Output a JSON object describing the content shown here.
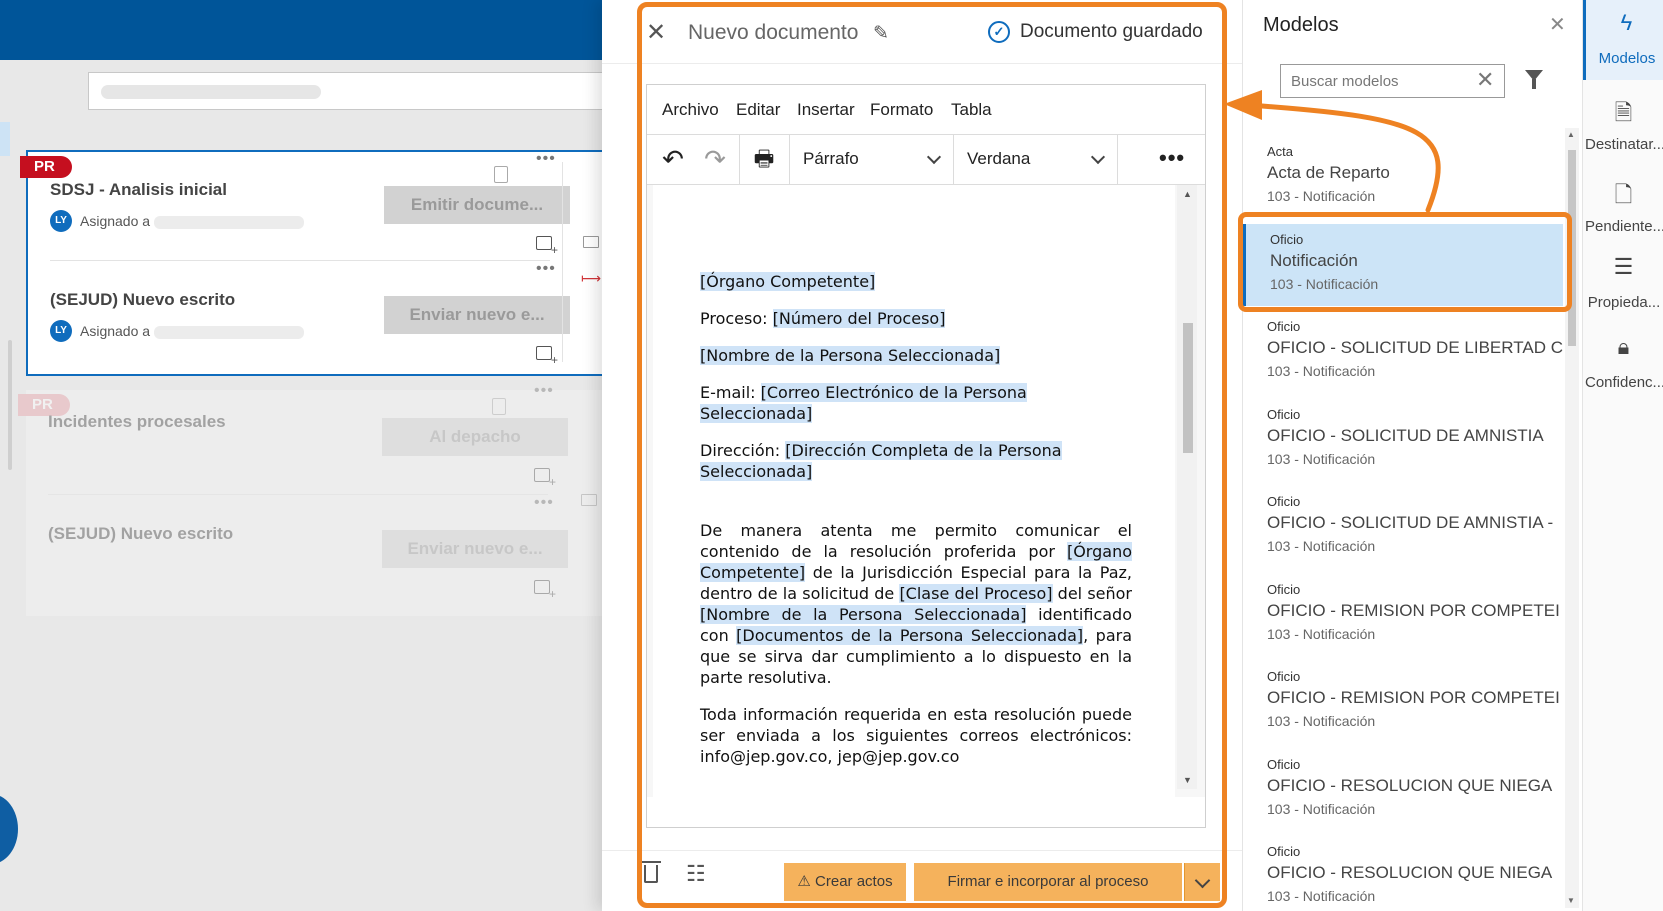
{
  "editor": {
    "title": "Nuevo documento",
    "save_status": "Documento guardado",
    "menu": [
      "Archivo",
      "Editar",
      "Insertar",
      "Formato",
      "Tabla"
    ],
    "block_format": "Párrafo",
    "font_family": "Verdana",
    "content": {
      "organ": "[Órgano Competente]",
      "proceso_label": "Proceso: ",
      "proceso_value": "[Número del Proceso]",
      "nombre": "[Nombre de la Persona Seleccionada]",
      "email_label": "E-mail: ",
      "email_value": "[Correo Electrónico de la Persona Seleccionada]",
      "direccion_label": "Dirección: ",
      "direccion_value": "[Dirección Completa de la Persona Seleccionada]",
      "p1_a": "De manera atenta me permito comunicar el contenido de la resolución proferida por ",
      "p1_organ": "[Órgano Competente]",
      "p1_b": " de la Jurisdicción Especial para la Paz, dentro de la solicitud de ",
      "p1_clase": "[Clase del Proceso]",
      "p1_c": " del señor ",
      "p1_nombre": "[Nombre de la Persona Seleccionada]",
      "p1_d": " identificado con ",
      "p1_docs": "[Documentos de la Persona Seleccionada]",
      "p1_e": ", para que se sirva dar cumplimiento a lo dispuesto en la parte resolutiva.",
      "p2": "Toda información requerida en esta resolución puede ser enviada a los siguientes correos electrónicos: info@jep.gov.co, jep@jep.gov.co"
    },
    "footer": {
      "create_acts": "⚠ Crear actos",
      "sign_incorporate": "Firmar e incorporar al proceso"
    }
  },
  "models": {
    "title": "Modelos",
    "search_placeholder": "Buscar modelos",
    "items": [
      {
        "category": "Acta",
        "name": "Acta de Reparto",
        "sub": "103 - Notificación",
        "selected": false
      },
      {
        "category": "Oficio",
        "name": "Notificación",
        "sub": "103 - Notificación",
        "selected": true
      },
      {
        "category": "Oficio",
        "name": "OFICIO - SOLICITUD DE LIBERTAD C",
        "sub": "103 - Notificación",
        "selected": false
      },
      {
        "category": "Oficio",
        "name": "OFICIO - SOLICITUD DE AMNISTIA",
        "sub": "103 - Notificación",
        "selected": false
      },
      {
        "category": "Oficio",
        "name": "OFICIO - SOLICITUD DE AMNISTIA -",
        "sub": "103 - Notificación",
        "selected": false
      },
      {
        "category": "Oficio",
        "name": "OFICIO - REMISION POR COMPETEI",
        "sub": "103 - Notificación",
        "selected": false
      },
      {
        "category": "Oficio",
        "name": "OFICIO - REMISION POR COMPETEI",
        "sub": "103 - Notificación",
        "selected": false
      },
      {
        "category": "Oficio",
        "name": "OFICIO - RESOLUCION QUE NIEGA",
        "sub": "103 - Notificación",
        "selected": false
      },
      {
        "category": "Oficio",
        "name": "OFICIO - RESOLUCION QUE NIEGA",
        "sub": "103 - Notificación",
        "selected": false
      }
    ]
  },
  "rail": [
    {
      "icon": "lightning-icon",
      "label": "Modelos",
      "active": true
    },
    {
      "icon": "search-document-icon",
      "label": "Destinatar...",
      "active": false
    },
    {
      "icon": "pending-document-icon",
      "label": "Pendiente...",
      "active": false
    },
    {
      "icon": "properties-icon",
      "label": "Propieda...",
      "active": false
    },
    {
      "icon": "lock-icon",
      "label": "Confidenc...",
      "active": false
    }
  ],
  "background": {
    "groups": [
      {
        "tag": "PR",
        "tasks": [
          {
            "title": "SDSJ - Analisis inicial",
            "assignee_initials": "LY",
            "assigned_label": "Asignado a",
            "action": "Emitir docume..."
          },
          {
            "title": "(SEJUD) Nuevo escrito",
            "assignee_initials": "LY",
            "assigned_label": "Asignado a",
            "action": "Enviar nuevo e..."
          }
        ]
      },
      {
        "tag": "PR",
        "tasks": [
          {
            "title": "Incidentes procesales",
            "action": "Al depacho"
          },
          {
            "title": "(SEJUD) Nuevo escrito",
            "action": "Enviar nuevo e..."
          }
        ]
      }
    ]
  },
  "colors": {
    "brand_blue": "#005599",
    "accent_blue": "#0f6cbd",
    "annotation_orange": "#ee8222",
    "button_orange": "#f5b25c",
    "selected_bg": "#cce4f7",
    "highlight_bg": "#cfe3f7"
  }
}
